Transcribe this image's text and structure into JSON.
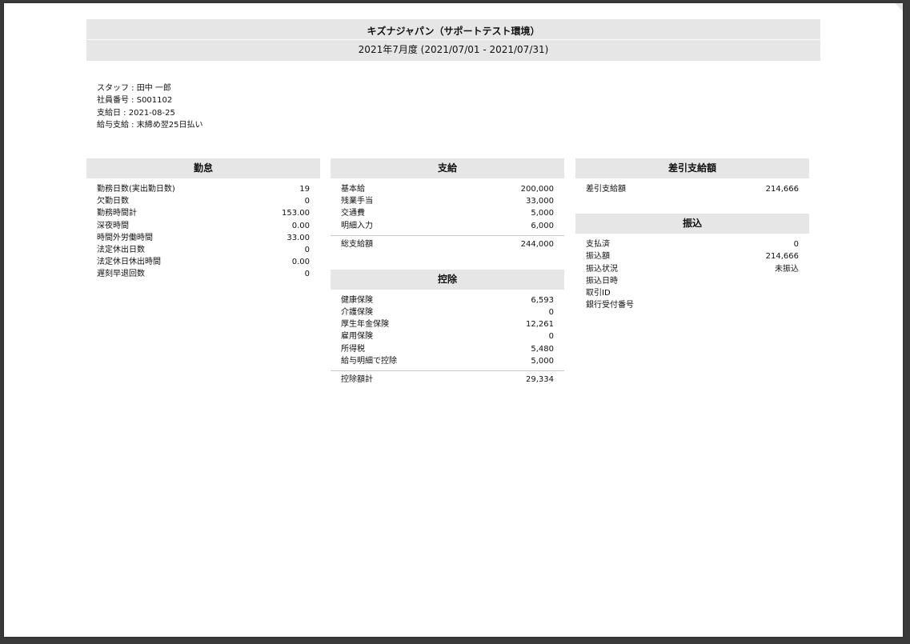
{
  "header": {
    "company": "キズナジャパン（サポートテスト環境）",
    "period": "2021年7月度 (2021/07/01 - 2021/07/31)"
  },
  "staff": {
    "name": "スタッフ : 田中 一郎",
    "employee_no": "社員番号 : S001102",
    "pay_date": "支給日 : 2021-08-25",
    "pay_terms": "給与支給 : 末締め翌25日払い"
  },
  "kintai": {
    "title": "勤怠",
    "rows": [
      {
        "label": "勤務日数(実出勤日数)",
        "value": "19"
      },
      {
        "label": "欠勤日数",
        "value": "0"
      },
      {
        "label": "勤務時間計",
        "value": "153.00"
      },
      {
        "label": "深夜時間",
        "value": "0.00"
      },
      {
        "label": "時間外労働時間",
        "value": "33.00"
      },
      {
        "label": "法定休出日数",
        "value": "0"
      },
      {
        "label": "法定休日休出時間",
        "value": "0.00"
      },
      {
        "label": "遅刻早退回数",
        "value": "0"
      }
    ]
  },
  "shikyu": {
    "title": "支給",
    "rows": [
      {
        "label": "基本給",
        "value": "200,000"
      },
      {
        "label": "残業手当",
        "value": "33,000"
      },
      {
        "label": "交通費",
        "value": "5,000"
      },
      {
        "label": "明細入力",
        "value": "6,000"
      }
    ],
    "total_label": "総支給額",
    "total_value": "244,000"
  },
  "koujo": {
    "title": "控除",
    "rows": [
      {
        "label": "健康保険",
        "value": "6,593"
      },
      {
        "label": "介護保険",
        "value": "0"
      },
      {
        "label": "厚生年金保険",
        "value": "12,261"
      },
      {
        "label": "雇用保険",
        "value": "0"
      },
      {
        "label": "所得税",
        "value": "5,480"
      },
      {
        "label": "給与明細で控除",
        "value": "5,000"
      }
    ],
    "total_label": "控除額計",
    "total_value": "29,334"
  },
  "sashihiki": {
    "title": "差引支給額",
    "rows": [
      {
        "label": "差引支給額",
        "value": "214,666"
      }
    ]
  },
  "furikomi": {
    "title": "振込",
    "rows": [
      {
        "label": "支払済",
        "value": "0"
      },
      {
        "label": "振込額",
        "value": "214,666"
      },
      {
        "label": "振込状況",
        "value": "未振込"
      },
      {
        "label": "振込日時",
        "value": ""
      },
      {
        "label": "取引ID",
        "value": ""
      },
      {
        "label": "銀行受付番号",
        "value": ""
      }
    ]
  }
}
